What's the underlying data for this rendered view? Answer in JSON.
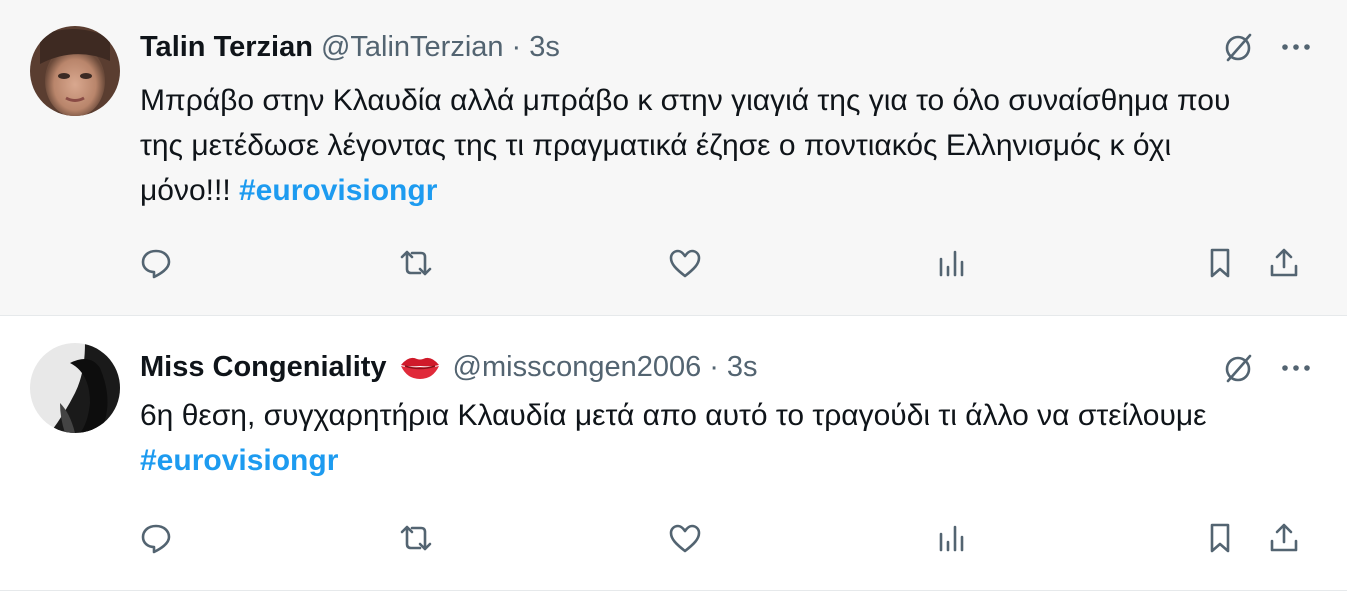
{
  "tweets": [
    {
      "author_name": "Talin Terzian",
      "handle": "@TalinTerzian",
      "separator": "·",
      "time": "3s",
      "text": "Μπράβο στην Κλαυδία αλλά μπράβο κ στην γιαγιά της για το όλο συναίσθημα που της μετέδωσε λέγοντας της τι πραγματικά έζησε ο ποντιακός Ελληνισμός κ όχι μόνο!!! ",
      "hashtag": "#eurovisiongr"
    },
    {
      "author_name": "Miss Congeniality",
      "name_emoji": "lips-icon",
      "handle": "@misscongen2006",
      "separator": "·",
      "time": "3s",
      "text": "6η θεση, συγχαρητήρια Κλαυδία μετά απο αυτό το τραγούδι τι άλλο να στείλουμε ",
      "hashtag": "#eurovisiongr"
    }
  ],
  "icons": {
    "top": [
      "grok-icon",
      "more-icon"
    ],
    "actions": [
      "reply-icon",
      "retweet-icon",
      "like-icon",
      "views-icon",
      "bookmark-icon",
      "share-icon"
    ]
  },
  "colors": {
    "link": "#1d9bf0",
    "secondary_text": "#536471",
    "icon": "#536471",
    "highlight_bg": "#f7f7f7"
  }
}
